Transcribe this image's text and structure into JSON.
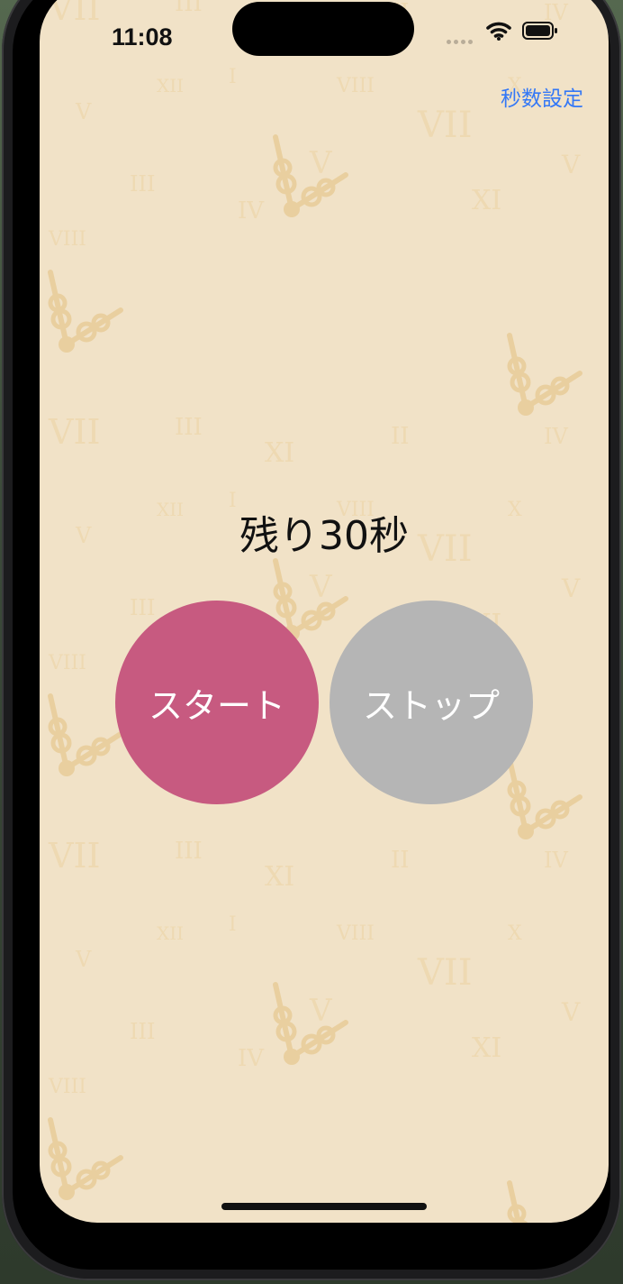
{
  "status_bar": {
    "time": "11:08"
  },
  "header": {
    "settings_label": "秒数設定"
  },
  "timer": {
    "remaining_text": "残り30秒"
  },
  "controls": {
    "start_label": "スタート",
    "stop_label": "ストップ"
  },
  "colors": {
    "background": "#f1e2c7",
    "pattern": "#e9cf9f",
    "start_button": "#c75a80",
    "stop_button": "#b5b5b5",
    "link": "#3478f6"
  },
  "icons": {
    "wifi": "wifi-icon",
    "battery": "battery-icon",
    "signal": "cellular-signal-icon"
  }
}
